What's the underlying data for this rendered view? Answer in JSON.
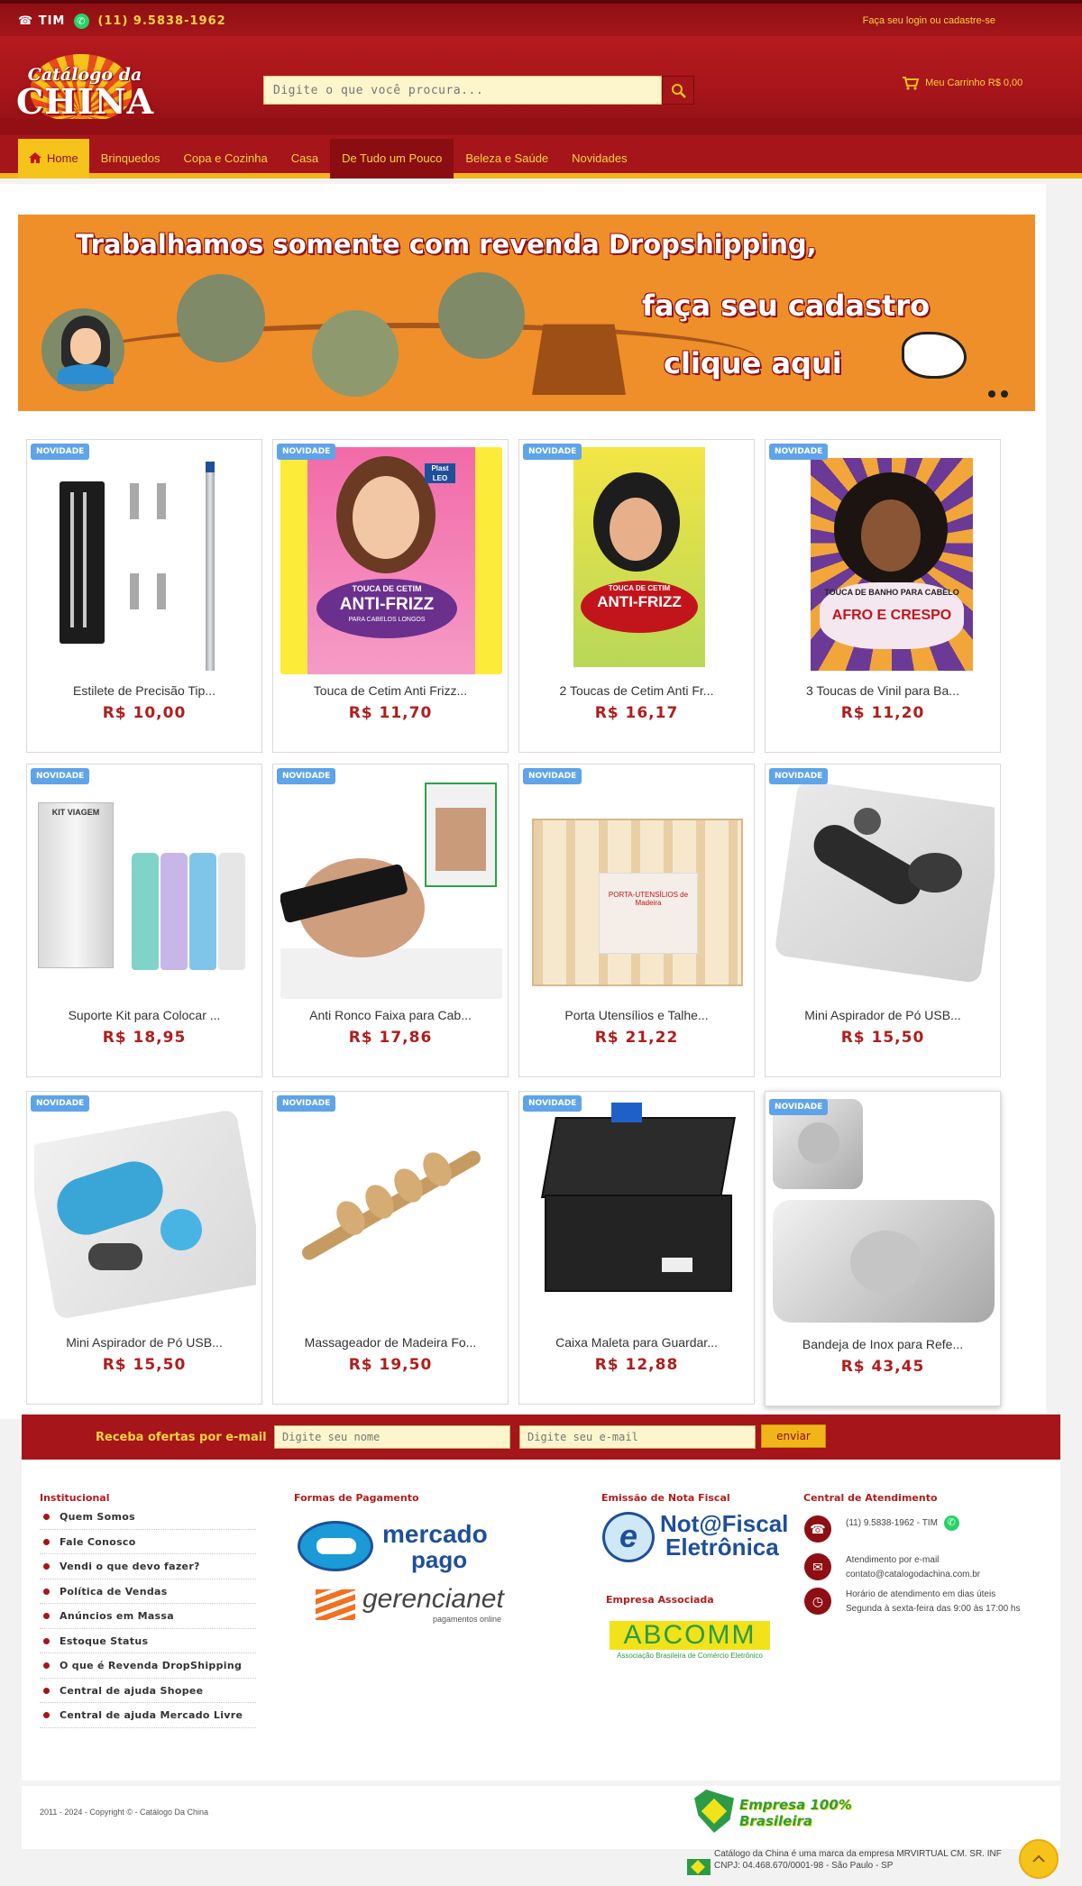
{
  "topbar": {
    "carrier": "☎ TIM",
    "phone": "(11) 9.5838-1962",
    "login_link": "Faça seu login ou cadastre-se"
  },
  "header": {
    "logo_line1": "Catálogo da",
    "logo_line2": "CHINA",
    "search_placeholder": "Digite o que você procura...",
    "cart_label": "Meu Carrinho R$ 0,00"
  },
  "nav": {
    "items": [
      "Home",
      "Brinquedos",
      "Copa e Cozinha",
      "Casa",
      "De Tudo um Pouco",
      "Beleza e Saúde",
      "Novidades"
    ],
    "active": "De Tudo um Pouco"
  },
  "banner": {
    "line1": "Trabalhamos somente com revenda Dropshipping,",
    "line2": "faça seu cadastro",
    "line3": "clique aqui"
  },
  "products": [
    {
      "badge": "NOVIDADE",
      "name": "Estilete de Precisão Tip...",
      "price": "R$ 10,00"
    },
    {
      "badge": "NOVIDADE",
      "name": "Touca de Cetim Anti Frizz...",
      "price": "R$ 11,70"
    },
    {
      "badge": "NOVIDADE",
      "name": "2 Toucas de Cetim Anti Fr...",
      "price": "R$ 16,17"
    },
    {
      "badge": "NOVIDADE",
      "name": "3 Toucas de Vinil para Ba...",
      "price": "R$ 11,20"
    },
    {
      "badge": "NOVIDADE",
      "name": "Suporte Kit para Colocar ...",
      "price": "R$ 18,95"
    },
    {
      "badge": "NOVIDADE",
      "name": "Anti Ronco Faixa para Cab...",
      "price": "R$ 17,86"
    },
    {
      "badge": "NOVIDADE",
      "name": "Porta Utensílios e Talhe...",
      "price": "R$ 21,22"
    },
    {
      "badge": "NOVIDADE",
      "name": "Mini Aspirador de Pó USB...",
      "price": "R$ 15,50"
    },
    {
      "badge": "NOVIDADE",
      "name": "Mini Aspirador de Pó USB...",
      "price": "R$ 15,50"
    },
    {
      "badge": "NOVIDADE",
      "name": "Massageador de Madeira Fo...",
      "price": "R$ 19,50"
    },
    {
      "badge": "NOVIDADE",
      "name": "Caixa Maleta para Guardar...",
      "price": "R$ 12,88"
    },
    {
      "badge": "NOVIDADE",
      "name": "Bandeja de Inox para Refe...",
      "price": "R$ 43,45"
    }
  ],
  "product_images": {
    "p2_brand": "Plast LEO",
    "p2_title": "TOUCA DE CETIM",
    "p2_big": "ANTI-FRIZZ",
    "p2_sub": "PARA CABELOS LONGOS",
    "p3_title": "TOUCA DE CETIM",
    "p3_big": "ANTI-FRIZZ",
    "p4_title": "TOUCA DE BANHO PARA CABELO",
    "p4_big": "AFRO E CRESPO",
    "p5_label": "KIT VIAGEM",
    "p7_label": "PORTA-UTENSÍLIOS de Madeira"
  },
  "newsletter": {
    "label": "Receba ofertas por e-mail",
    "name_placeholder": "Digite seu nome",
    "email_placeholder": "Digite seu e-mail",
    "button": "enviar"
  },
  "footer": {
    "institucional_title": "Institucional",
    "institucional_items": [
      "Quem Somos",
      "Fale Conosco",
      "Vendi o que devo fazer?",
      "Política de Vendas",
      "Anúncios em Massa",
      "Estoque Status",
      "O que é Revenda DropShipping",
      "Central de ajuda Shopee",
      "Central de ajuda Mercado Livre"
    ],
    "pagamento_title": "Formas de Pagamento",
    "mercadopago_1": "mercado",
    "mercadopago_2": "pago",
    "gerencianet": "gerencianet",
    "gerencianet_sub": "pagamentos online",
    "nfe_title": "Emissão de Nota Fiscal",
    "nfe_1": "Not@Fiscal",
    "nfe_2": "Eletrônica",
    "associada_title": "Empresa Associada",
    "abcomm": "ABCOMM",
    "abcomm_sub": "Associação Brasileira de Comércio Eletrônico",
    "atendimento_title": "Central de Atendimento",
    "phone": "(11) 9.5838-1962 - TIM",
    "email_label": "Atendimento por e-mail",
    "email": "contato@catalogodachina.com.br",
    "hours_label": "Horário de atendimento em dias úteis",
    "hours": "Segunda à sexta-feira das 9:00 às 17:00 hs"
  },
  "copyright": "2011 - 2024 - Copyright © - Catálogo Da China",
  "brasil_badge": "Empresa 100% Brasileira",
  "company_line1": "Catálogo da China é uma marca da empresa MRVIRTUAL CM. SR. INF",
  "company_line2": "CNPJ: 04.468.670/0001-98 - São Paulo - SP",
  "colors": {
    "primary_red": "#a5151a",
    "accent_yellow": "#f6c31b",
    "price_red": "#b01d1d",
    "badge_blue": "#5fa4e8"
  }
}
